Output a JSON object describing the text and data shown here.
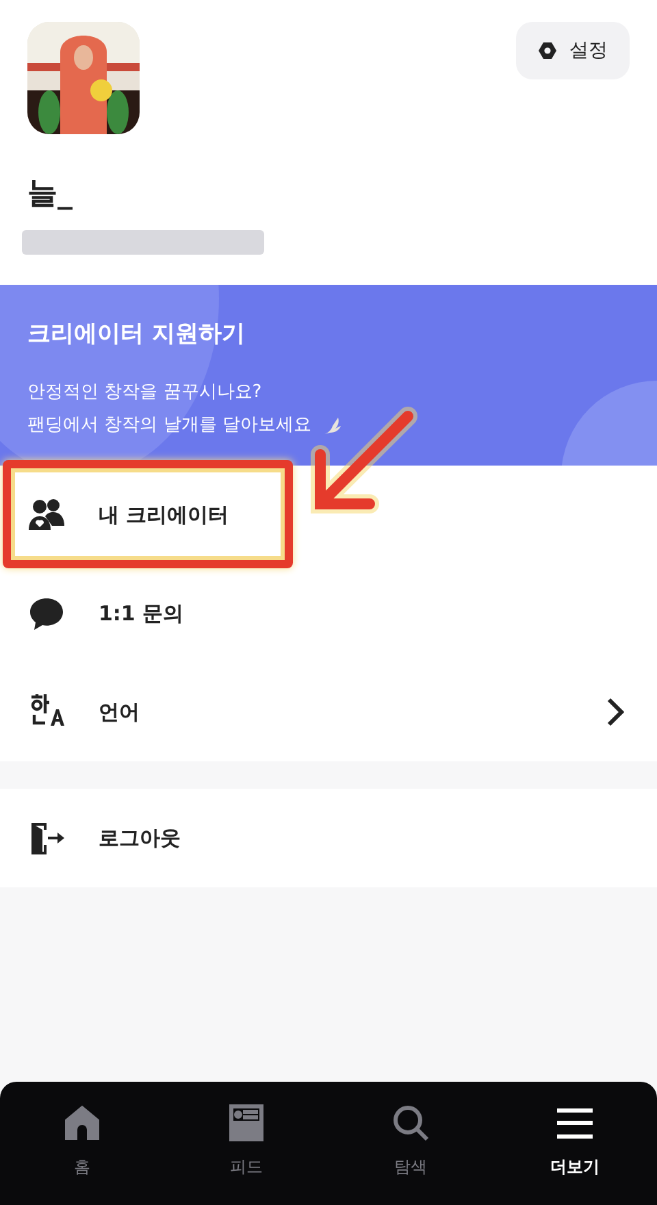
{
  "profile": {
    "name": "늘_",
    "settings_button": "설정"
  },
  "banner": {
    "title": "크리에이터 지원하기",
    "lines": [
      "안정적인 창작을 꿈꾸시나요?",
      "팬딩에서 창작의 날개를 달아보세요"
    ]
  },
  "menu": [
    {
      "kind": "creators",
      "label": "내 크리에이터",
      "highlighted": true,
      "chevron": false
    },
    {
      "kind": "chat",
      "label": "1:1 문의",
      "highlighted": false,
      "chevron": false
    },
    {
      "kind": "language",
      "label": "언어",
      "highlighted": false,
      "chevron": true
    }
  ],
  "footer_menu": [
    {
      "kind": "logout",
      "label": "로그아웃",
      "highlighted": false,
      "chevron": false
    }
  ],
  "bottom_nav": [
    {
      "kind": "home",
      "label": "홈",
      "selected": false
    },
    {
      "kind": "feed",
      "label": "피드",
      "selected": false
    },
    {
      "kind": "search",
      "label": "탐색",
      "selected": false
    },
    {
      "kind": "menu",
      "label": "더보기",
      "selected": true
    }
  ]
}
